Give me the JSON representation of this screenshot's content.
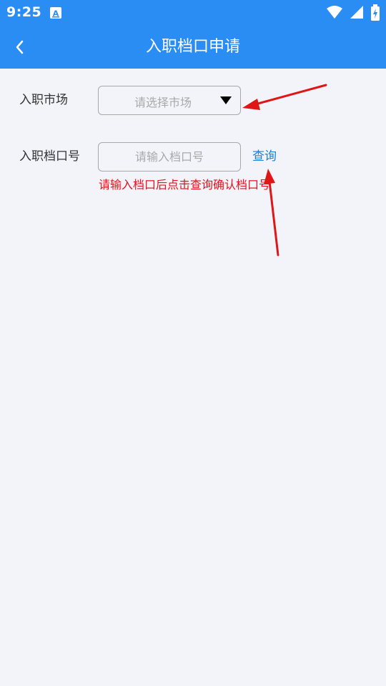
{
  "status_bar": {
    "time": "9:25",
    "app_icon": "a-icon",
    "icons": [
      "wifi-icon",
      "signal-icon",
      "battery-charging-icon"
    ]
  },
  "app_bar": {
    "back_icon": "chevron-left-icon",
    "title": "入职档口申请"
  },
  "form": {
    "market": {
      "label": "入职市场",
      "placeholder": "请选择市场",
      "arrow_icon": "caret-down-icon"
    },
    "stall": {
      "label": "入职档口号",
      "placeholder": "请输入档口号",
      "value": "",
      "query_label": "查询",
      "hint": "请输入档口后点击查询确认档口号"
    }
  },
  "colors": {
    "primary": "#2A8DF4",
    "background": "#F2F4F9",
    "link": "#1B7FE0",
    "hint": "#E8111B",
    "annotation_arrow": "#E01515"
  }
}
